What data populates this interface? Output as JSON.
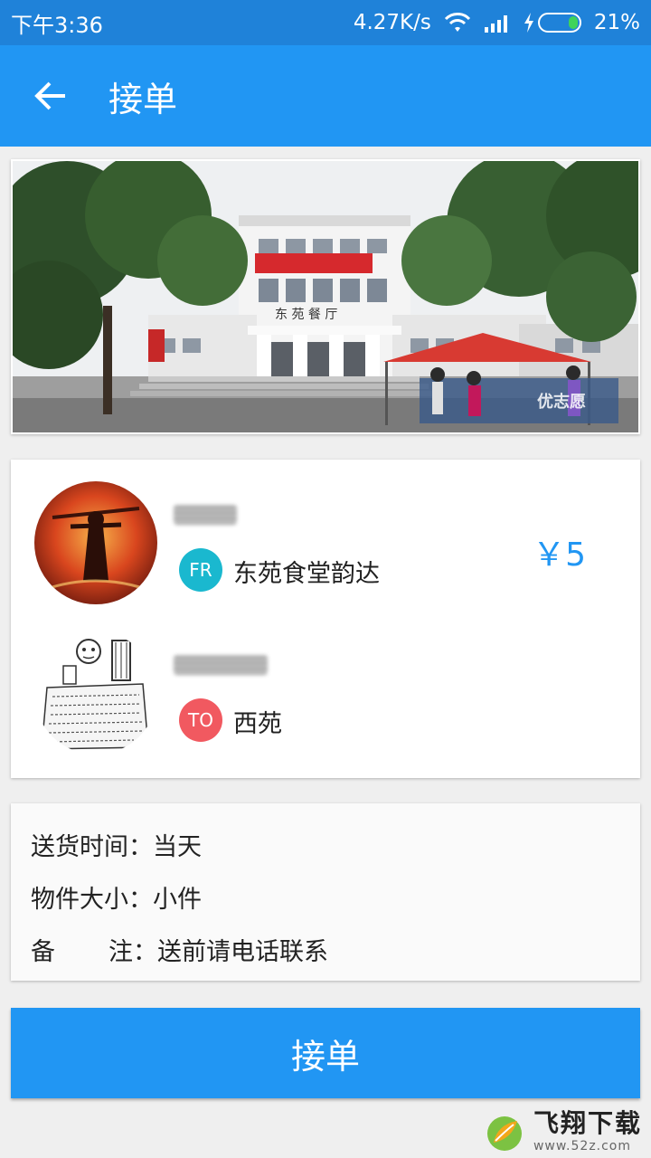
{
  "status_bar": {
    "time": "下午3:36",
    "speed": "4.27K/s",
    "battery": "21%",
    "battery_level": 0.21
  },
  "app_bar": {
    "title": "接单",
    "back_icon": "arrow-left-icon"
  },
  "photo": {
    "sign_text": "东 苑 餐 厅",
    "watermark": "优志愿"
  },
  "route": {
    "price": "￥5",
    "from": {
      "tag": "FR",
      "place": "东苑食堂韵达",
      "tag_color": "#1ab8cf"
    },
    "to": {
      "tag": "TO",
      "place": "西苑",
      "tag_color": "#f15960"
    }
  },
  "info": {
    "delivery_time_label": "送货时间：",
    "delivery_time_value": "当天",
    "size_label": "物件大小：",
    "size_value": "小件",
    "note_label_a": "备",
    "note_label_b": "注：",
    "note_value": "送前请电话联系"
  },
  "action": {
    "accept_label": "接单"
  },
  "watermark": {
    "main": "飞翔下载",
    "sub": "www.52z.com"
  },
  "colors": {
    "primary": "#2196f3",
    "status_bar": "#1f82d9"
  }
}
